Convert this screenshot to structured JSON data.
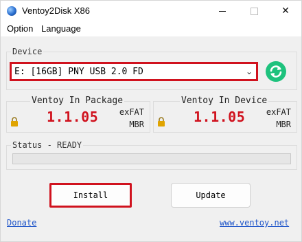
{
  "window": {
    "title": "Ventoy2Disk  X86"
  },
  "menu": {
    "items": [
      "Option",
      "Language"
    ]
  },
  "device": {
    "group_label": "Device",
    "selected": "E: [16GB] PNY USB 2.0 FD",
    "refresh_icon": "refresh-icon"
  },
  "package": {
    "label": "Ventoy In Package",
    "version": "1.1.05",
    "filesystem": "exFAT",
    "partition": "MBR"
  },
  "installed": {
    "label": "Ventoy In Device",
    "version": "1.1.05",
    "filesystem": "exFAT",
    "partition": "MBR"
  },
  "status": {
    "label": "Status - READY",
    "progress": 0
  },
  "actions": {
    "install": "Install",
    "update": "Update"
  },
  "links": {
    "donate": "Donate",
    "website": "www.ventoy.net"
  },
  "colors": {
    "accent_red": "#d0121e",
    "refresh_green": "#1ec27d",
    "link_blue": "#1f55c9",
    "lock_gold": "#e0a400"
  }
}
